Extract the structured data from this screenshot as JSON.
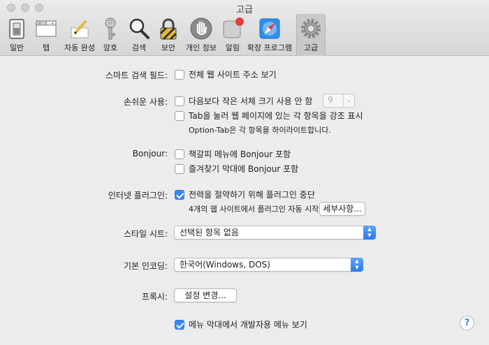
{
  "window": {
    "title": "고급"
  },
  "toolbar": [
    {
      "label": "일반",
      "icon": "general-switch-icon"
    },
    {
      "label": "탭",
      "icon": "tabs-icon"
    },
    {
      "label": "자동 완성",
      "icon": "autofill-pencil-icon"
    },
    {
      "label": "암호",
      "icon": "key-icon"
    },
    {
      "label": "검색",
      "icon": "magnifier-icon"
    },
    {
      "label": "보안",
      "icon": "lock-icon"
    },
    {
      "label": "개인 정보",
      "icon": "hand-icon"
    },
    {
      "label": "알림",
      "icon": "notification-badge-icon"
    },
    {
      "label": "확장 프로그램",
      "icon": "compass-icon"
    },
    {
      "label": "고급",
      "icon": "gear-icon",
      "active": true
    }
  ],
  "smart_search": {
    "label": "스마트 검색 필드:",
    "option": "전체 웹 사이트 주소 보기",
    "checked": false
  },
  "accessibility": {
    "label": "손쉬운 사용:",
    "font_size_option": "다음보다 작은 서체 크기 사용 안 함",
    "font_size_value": "9",
    "tab_option": "Tab을 눌러 웹 페이지에 있는 각 항목을 강조 표시",
    "tab_note": "Option-Tab은 각 항목을 하이라이트합니다."
  },
  "bonjour": {
    "label": "Bonjour:",
    "bookmarks_menu": "책갈피 메뉴에 Bonjour 포함",
    "favorites_bar": "즐겨찾기 막대에 Bonjour 포함"
  },
  "plugins": {
    "label": "인터넷 플러그인:",
    "option": "전력을 절약하기 위해 플러그인 중단",
    "checked": true,
    "note": "4개의 웹 사이트에서 플러그인 자동 시작",
    "details_button": "세부사항..."
  },
  "stylesheet": {
    "label": "스타일 시트:",
    "value": "선택된 항목 없음"
  },
  "encoding": {
    "label": "기본 인코딩:",
    "value": "한국어(Windows, DOS)"
  },
  "proxy": {
    "label": "프록시:",
    "button": "설정 변경..."
  },
  "develop_menu": {
    "option": "메뉴 막대에서 개발자용 메뉴 보기",
    "checked": true
  },
  "help": {
    "label": "?"
  },
  "colors": {
    "accent": "#3a8af4"
  }
}
